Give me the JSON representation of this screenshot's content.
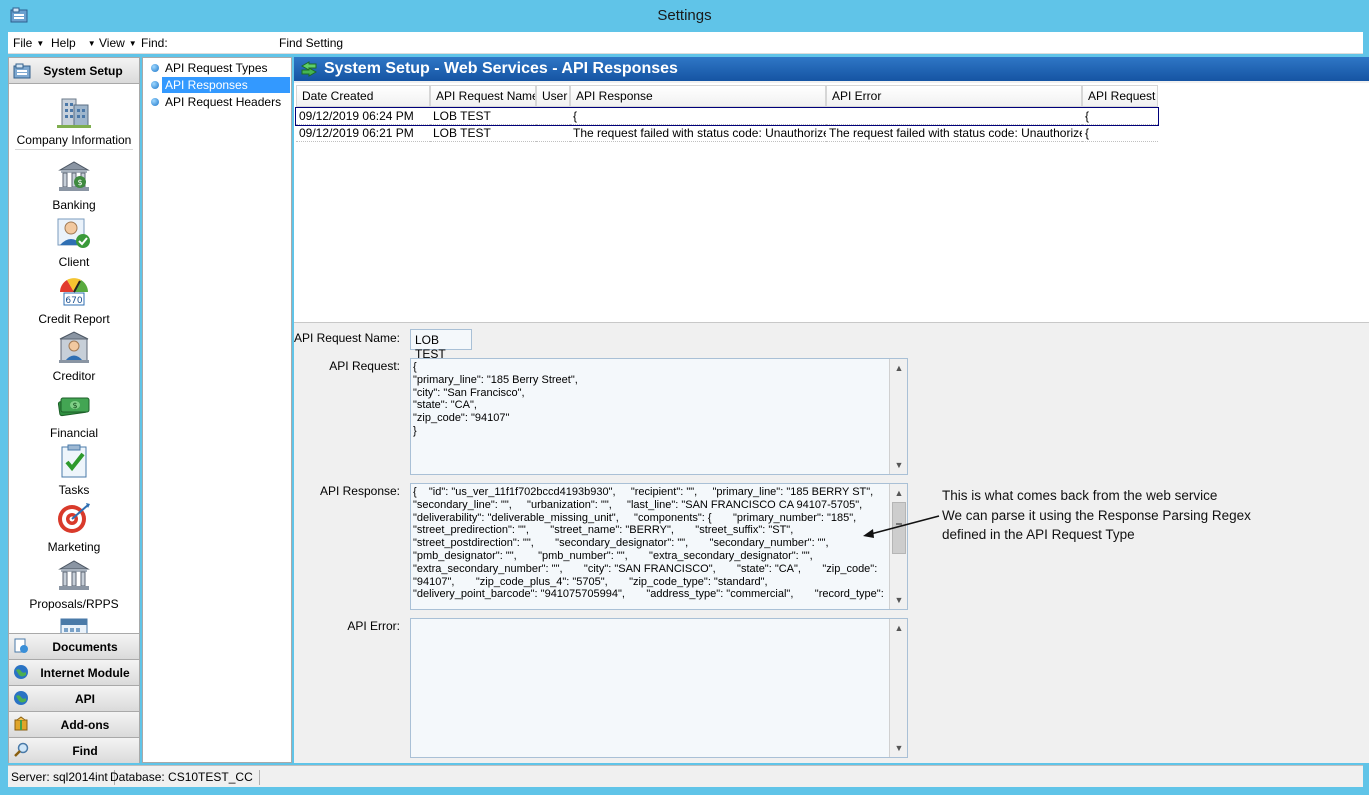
{
  "window": {
    "title": "Settings"
  },
  "menu": {
    "file": "File",
    "help": "Help",
    "view": "View",
    "find_label": "Find:",
    "find_setting": "Find Setting"
  },
  "nav": {
    "header": "System Setup",
    "items": [
      {
        "label": "Company Information",
        "icon": "building-icon"
      },
      {
        "label": "Banking",
        "icon": "bank-icon"
      },
      {
        "label": "Client",
        "icon": "client-icon"
      },
      {
        "label": "Credit Report",
        "icon": "gauge-icon"
      },
      {
        "label": "Creditor",
        "icon": "creditor-icon"
      },
      {
        "label": "Financial",
        "icon": "money-icon"
      },
      {
        "label": "Tasks",
        "icon": "checklist-icon"
      },
      {
        "label": "Marketing",
        "icon": "target-icon"
      },
      {
        "label": "Proposals/RPPS",
        "icon": "bank-icon"
      }
    ],
    "credit_score": "670",
    "sections": [
      "Documents",
      "Internet Module",
      "API",
      "Add-ons",
      "Find"
    ]
  },
  "tree": {
    "items": [
      "API Request Types",
      "API Responses",
      "API Request Headers"
    ],
    "selected_index": 1
  },
  "main": {
    "title": "System Setup - Web Services - API Responses",
    "columns": [
      "Date Created",
      "API Request Name",
      "User",
      "API Response",
      "API Error",
      "API Request"
    ],
    "rows": [
      [
        "09/12/2019 06:24 PM",
        "LOB TEST",
        "",
        "{",
        "",
        "{"
      ],
      [
        "09/12/2019 06:21 PM",
        "LOB TEST",
        "",
        "The request failed with status code: Unauthorized",
        "The request failed with status code: Unauthorized",
        "{"
      ]
    ],
    "labels": {
      "request_name": "API Request Name:",
      "request": "API Request:",
      "response": "API Response:",
      "error": "API Error:"
    },
    "request_name_value": "LOB TEST",
    "request_value": "{\n\"primary_line\": \"185 Berry Street\",\n\"city\": \"San Francisco\",\n\"state\": \"CA\",\n\"zip_code\": \"94107\"\n}",
    "response_value": "{    \"id\": \"us_ver_11f1f702bccd4193b930\",     \"recipient\": \"\",     \"primary_line\": \"185 BERRY ST\",\n\"secondary_line\": \"\",     \"urbanization\": \"\",     \"last_line\": \"SAN FRANCISCO CA 94107-5705\",\n\"deliverability\": \"deliverable_missing_unit\",     \"components\": {       \"primary_number\": \"185\",\n\"street_predirection\": \"\",       \"street_name\": \"BERRY\",       \"street_suffix\": \"ST\",\n\"street_postdirection\": \"\",       \"secondary_designator\": \"\",       \"secondary_number\": \"\",\n\"pmb_designator\": \"\",       \"pmb_number\": \"\",       \"extra_secondary_designator\": \"\",\n\"extra_secondary_number\": \"\",       \"city\": \"SAN FRANCISCO\",       \"state\": \"CA\",       \"zip_code\":\n\"94107\",       \"zip_code_plus_4\": \"5705\",       \"zip_code_type\": \"standard\",\n\"delivery_point_barcode\": \"941075705994\",       \"address_type\": \"commercial\",       \"record_type\":",
    "error_value": ""
  },
  "annotation": {
    "line1": "This is what comes back from the web service",
    "line2": "We can parse it using the Response Parsing Regex",
    "line3": "defined in the API Request Type"
  },
  "status": {
    "server": "Server: sql2014int",
    "database": "Database: CS10TEST_CC"
  },
  "colors": {
    "titlebar": "#60c4e8",
    "header_band": "#1e63b4",
    "selection": "#3399ff"
  }
}
